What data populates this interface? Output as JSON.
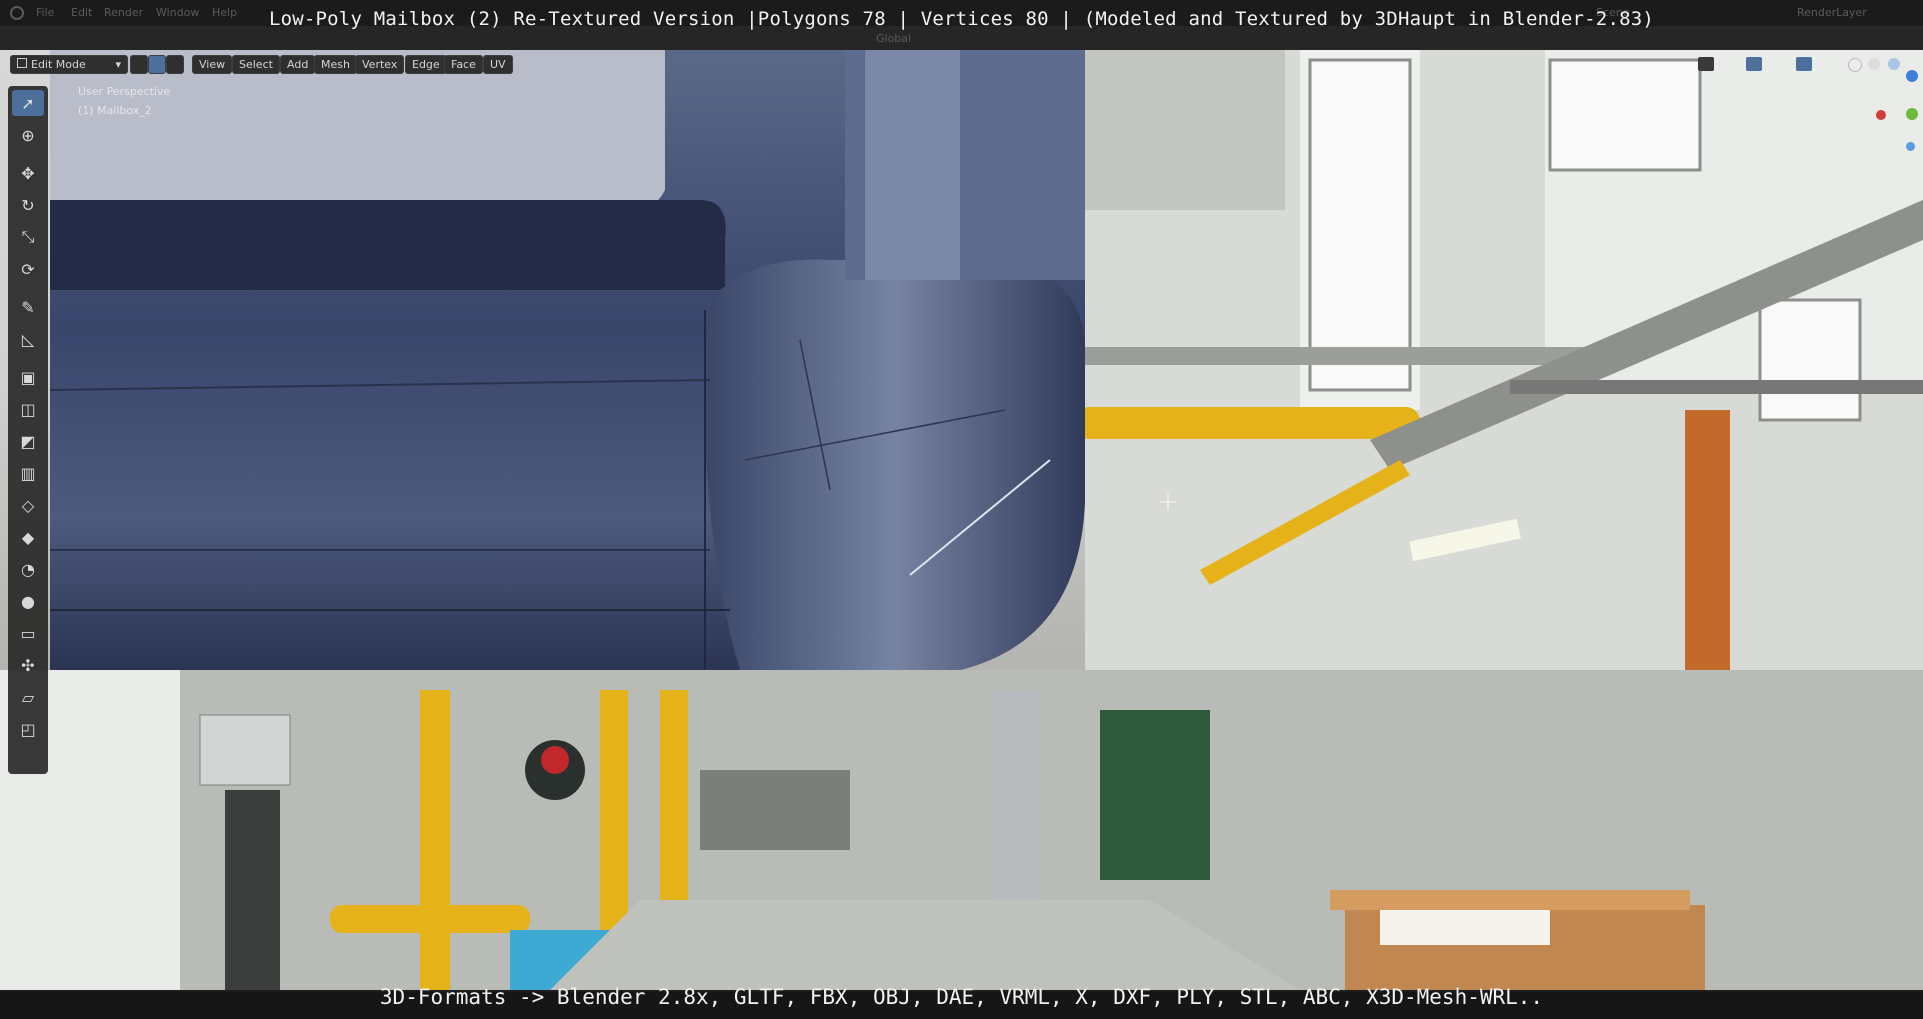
{
  "app": {
    "title_overlay": "Low-Poly Mailbox (2) Re-Textured Version |Polygons 78 | Vertices 80 | (Modeled and Textured by 3DHaupt in Blender-2.83)",
    "caption": "3D-Formats -> Blender 2.8x, GLTF, FBX, OBJ, DAE, VRML, X, DXF, PLY, STL, ABC, X3D-Mesh-WRL.."
  },
  "menu": {
    "items": [
      "File",
      "Edit",
      "Render",
      "Window",
      "Help"
    ],
    "scene_label": "Scene",
    "render_layer": "RenderLayer",
    "transform_orientation": "Global"
  },
  "viewport_header": {
    "mode": "Edit Mode",
    "buttons": [
      "View",
      "Select",
      "Add",
      "Mesh",
      "Vertex",
      "Edge",
      "Face",
      "UV"
    ]
  },
  "viewport": {
    "perspective": "User Perspective",
    "object": "(1) Mailbox_2"
  },
  "toolbar": {
    "tools": [
      "select-box",
      "cursor",
      "move",
      "rotate",
      "scale",
      "transform",
      "annotate",
      "measure",
      "extrude",
      "inset",
      "bevel",
      "loop-cut",
      "knife",
      "poly-build",
      "spin",
      "smooth",
      "edge-slide",
      "shrink-fatten",
      "shear",
      "rip"
    ],
    "active": "select-box"
  },
  "colors": {
    "accent": "#4d6f9b",
    "mailbox": "#3a4668",
    "pipe_yellow": "#e5b21a"
  }
}
